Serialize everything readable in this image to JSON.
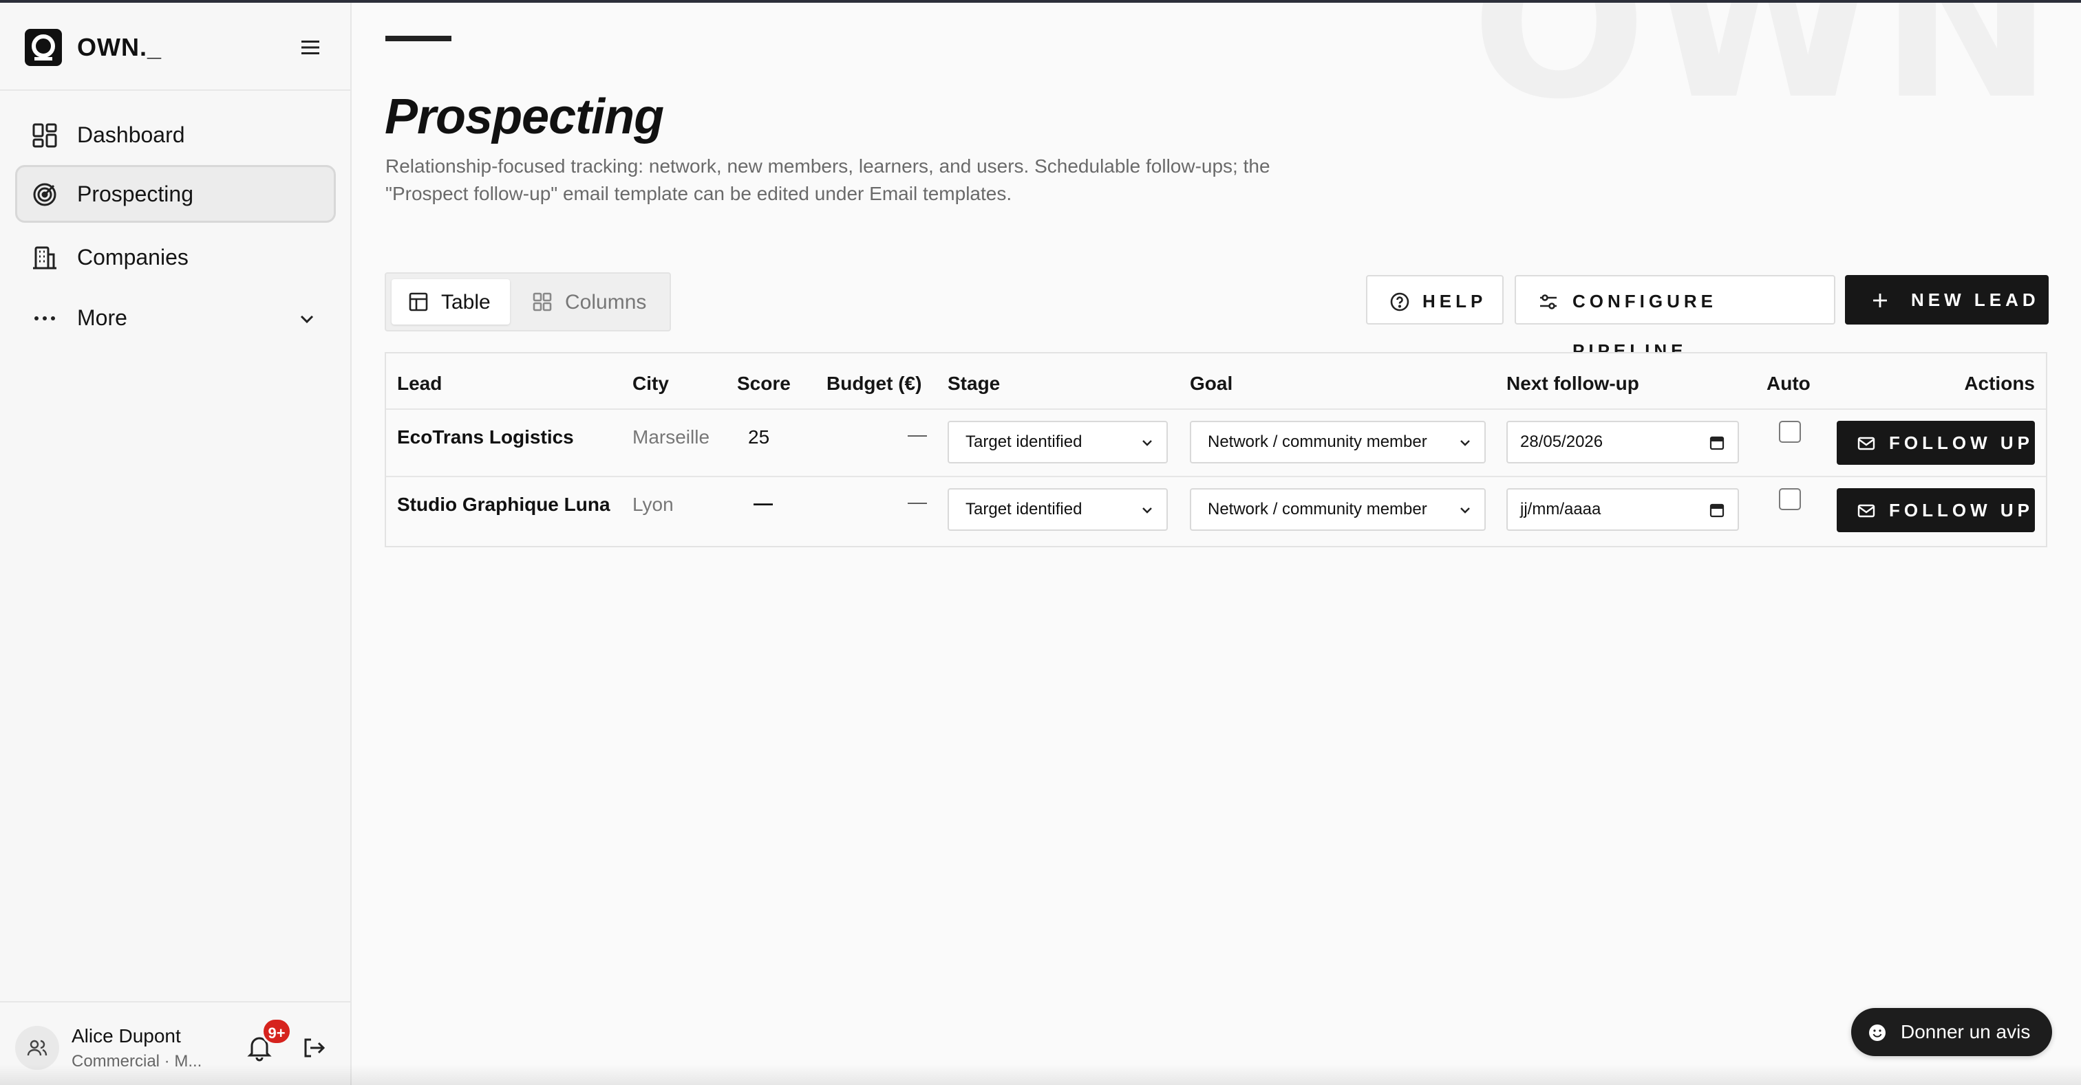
{
  "brand": {
    "name": "OWN._"
  },
  "sidebar": {
    "items": [
      {
        "label": "Dashboard",
        "icon": "dashboard-grid-icon"
      },
      {
        "label": "Prospecting",
        "icon": "radar-target-icon",
        "active": true
      },
      {
        "label": "Companies",
        "icon": "building-icon"
      },
      {
        "label": "More",
        "icon": "more-dots-icon"
      }
    ]
  },
  "user": {
    "name": "Alice Dupont",
    "role": "Commercial · M...",
    "notifications": "9+"
  },
  "page": {
    "watermark": "OWN",
    "title": "Prospecting",
    "description": "Relationship-focused tracking: network, new members, learners, and users. Schedulable follow-ups; the \"Prospect follow-up\" email template can be edited under Email templates."
  },
  "views": {
    "table": "Table",
    "columns": "Columns"
  },
  "toolbar": {
    "help": "HELP",
    "configure": "CONFIGURE PIPELINE",
    "new_lead": "NEW LEAD"
  },
  "table": {
    "headers": {
      "lead": "Lead",
      "city": "City",
      "score": "Score",
      "budget": "Budget (€)",
      "stage": "Stage",
      "goal": "Goal",
      "next": "Next follow-up",
      "auto": "Auto",
      "actions": "Actions"
    },
    "rows": [
      {
        "lead": "EcoTrans Logistics",
        "city": "Marseille",
        "score": "25",
        "budget": "—",
        "stage": "Target identified",
        "goal": "Network / community member",
        "next": "28/05/2026",
        "auto": false,
        "action": "FOLLOW UP"
      },
      {
        "lead": "Studio Graphique Luna",
        "city": "Lyon",
        "score": "—",
        "budget": "—",
        "stage": "Target identified",
        "goal": "Network / community member",
        "next": "jj/mm/aaaa",
        "auto": false,
        "action": "FOLLOW UP"
      }
    ]
  },
  "feedback": {
    "label": "Donner un avis"
  }
}
